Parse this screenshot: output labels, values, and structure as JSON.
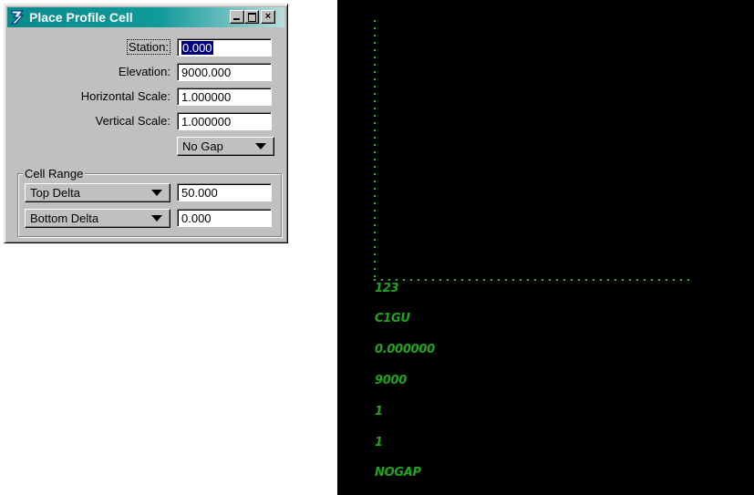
{
  "dialog": {
    "title": "Place Profile Cell",
    "icon": "bentley-b-icon",
    "title_buttons": {
      "minimize": "minimize-icon",
      "maximize": "maximize-icon",
      "close": "×"
    },
    "fields": {
      "station": {
        "label": "Station:",
        "value": "0.000"
      },
      "elevation": {
        "label": "Elevation:",
        "value": "9000.000"
      },
      "horizontal_scale": {
        "label": "Horizontal Scale:",
        "value": "1.000000"
      },
      "vertical_scale": {
        "label": "Vertical Scale:",
        "value": "1.000000"
      }
    },
    "gap_option": "No Gap",
    "cell_range": {
      "title": "Cell Range",
      "top": {
        "option": "Top Delta",
        "value": "50.000"
      },
      "bottom": {
        "option": "Bottom Delta",
        "value": "0.000"
      }
    }
  },
  "view": {
    "background": "#000000",
    "line_color": "#2bb52b",
    "text_color": "#1fa51f",
    "cell_texts": [
      "123",
      "C1GU",
      "0.000000",
      "9000",
      "1",
      "1",
      "NOGAP"
    ]
  }
}
